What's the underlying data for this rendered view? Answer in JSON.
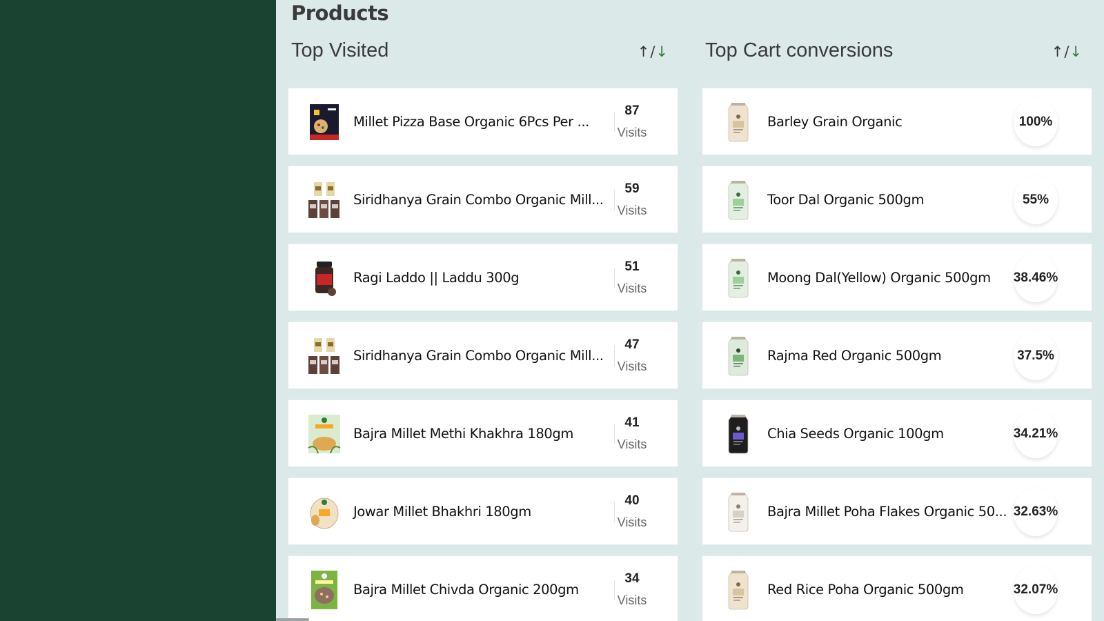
{
  "page": {
    "title": "Products"
  },
  "top_visited": {
    "title": "Top Visited",
    "sort": {
      "up": "↑",
      "sep": "/",
      "down": "↓"
    },
    "metric_label": "Visits",
    "items": [
      {
        "name": "Millet Pizza Base Organic 6Pcs Per ...",
        "visits": "87",
        "thumb": "pizza-box"
      },
      {
        "name": "Siridhanya Grain Combo Organic Mill...",
        "visits": "59",
        "thumb": "combo-pack"
      },
      {
        "name": "Ragi Laddo || Laddu 300g",
        "visits": "51",
        "thumb": "jar"
      },
      {
        "name": "Siridhanya Grain Combo Organic Mill...",
        "visits": "47",
        "thumb": "combo-pack"
      },
      {
        "name": "Bajra Millet Methi Khakhra 180gm",
        "visits": "41",
        "thumb": "khakhra-pack"
      },
      {
        "name": "Jowar Millet Bhakhri 180gm",
        "visits": "40",
        "thumb": "round-pack"
      },
      {
        "name": "Bajra Millet Chivda Organic 200gm",
        "visits": "34",
        "thumb": "chivda-pack"
      }
    ]
  },
  "top_cart": {
    "title": "Top Cart conversions",
    "sort": {
      "up": "↑",
      "sep": "/",
      "down": "↓"
    },
    "items": [
      {
        "name": "Barley Grain Organic",
        "pct": "100%",
        "thumb": "pouch-beige"
      },
      {
        "name": "Toor Dal Organic 500gm",
        "pct": "55%",
        "thumb": "pouch-green"
      },
      {
        "name": "Moong Dal(Yellow) Organic 500gm",
        "pct": "38.46%",
        "thumb": "pouch-green"
      },
      {
        "name": "Rajma Red Organic 500gm",
        "pct": "37.5%",
        "thumb": "pouch-green-dark"
      },
      {
        "name": "Chia Seeds Organic 100gm",
        "pct": "34.21%",
        "thumb": "pouch-black"
      },
      {
        "name": "Bajra Millet Poha Flakes Organic 50...",
        "pct": "32.63%",
        "thumb": "pouch-white"
      },
      {
        "name": "Red Rice Poha Organic 500gm",
        "pct": "32.07%",
        "thumb": "pouch-beige"
      }
    ]
  },
  "colors": {
    "sidebar": "#1b4332",
    "background": "#dbe9e8",
    "card": "#ffffff",
    "accent_green": "#2d7a3a"
  }
}
